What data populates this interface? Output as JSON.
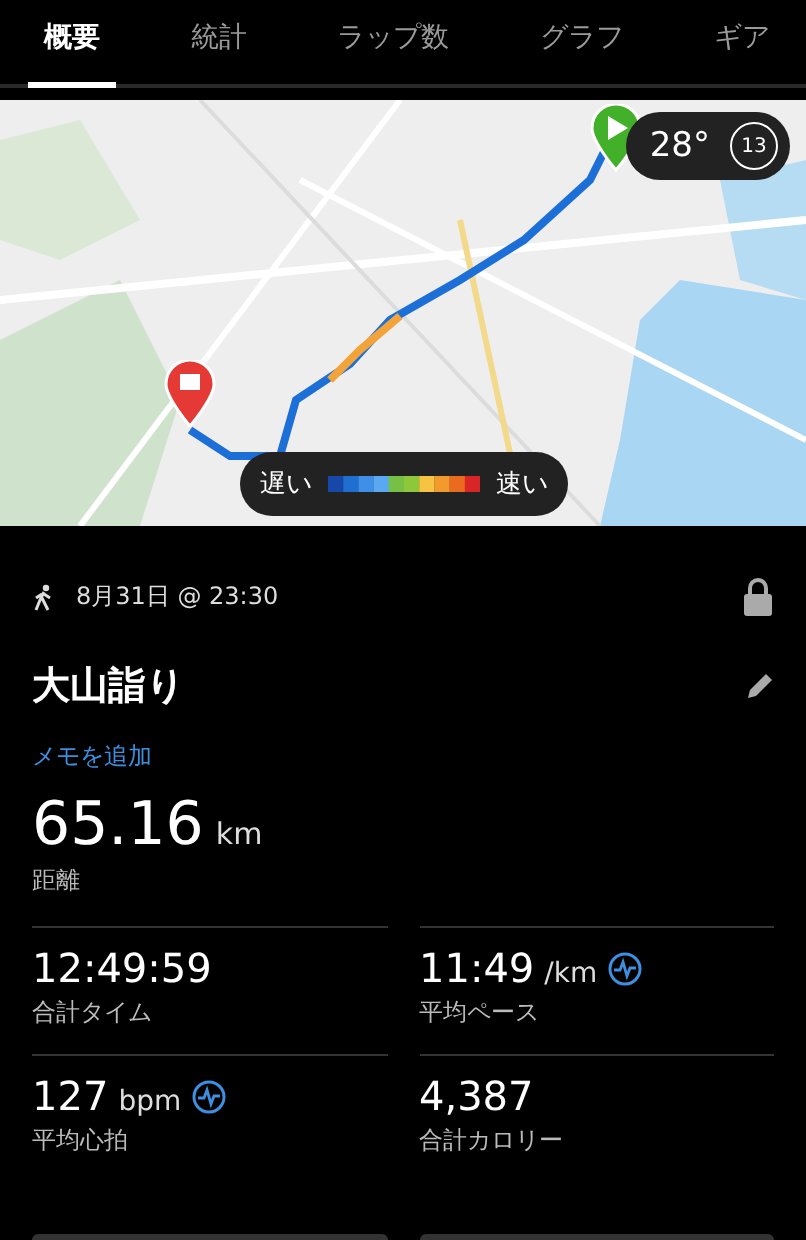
{
  "tabs": [
    {
      "label": "概要",
      "selected": true
    },
    {
      "label": "統計",
      "selected": false
    },
    {
      "label": "ラップ数",
      "selected": false
    },
    {
      "label": "グラフ",
      "selected": false
    },
    {
      "label": "ギア",
      "selected": false
    }
  ],
  "map": {
    "weather": {
      "temperature": "28°",
      "wind": "13"
    },
    "legend": {
      "slow": "遅い",
      "fast": "速い"
    }
  },
  "activity": {
    "date": "8月31日 @ 23:30",
    "title": "大山詣り",
    "note_link": "メモを追加",
    "distance": {
      "value": "65.16",
      "unit": "km",
      "label": "距離"
    }
  },
  "stats": [
    {
      "value": "12:49:59",
      "label": "合計タイム",
      "graph_icon": false
    },
    {
      "value": "11:49",
      "unit": "/km",
      "label": "平均ペース",
      "graph_icon": true
    },
    {
      "value": "127",
      "unit": "bpm",
      "label": "平均心拍",
      "graph_icon": true
    },
    {
      "value": "4,387",
      "label": "合計カロリー",
      "graph_icon": false
    }
  ]
}
